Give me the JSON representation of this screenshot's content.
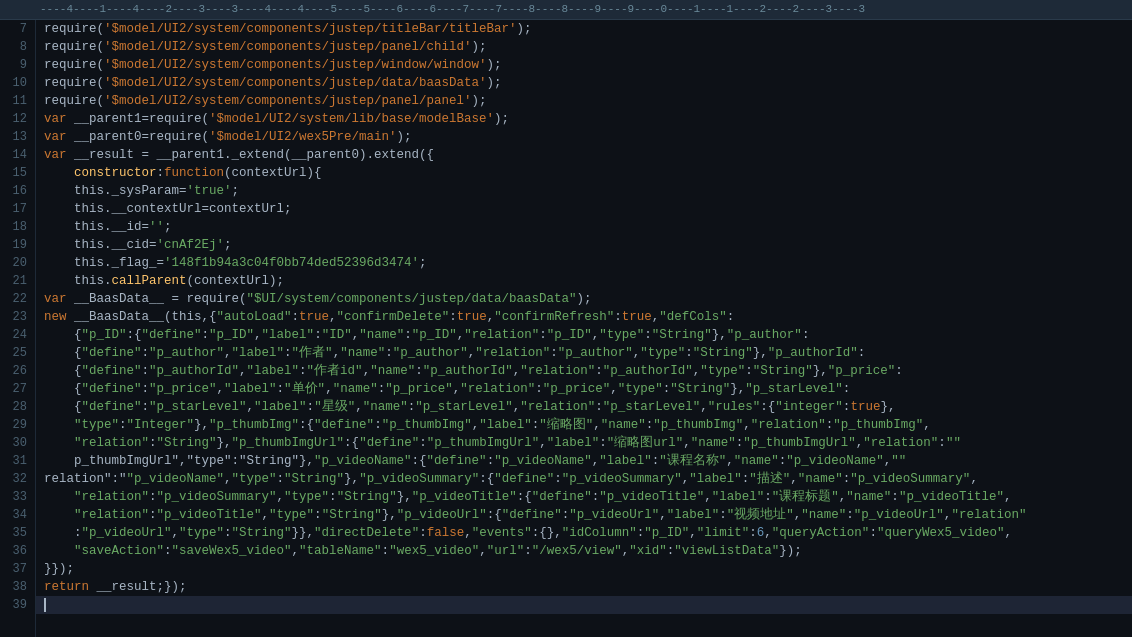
{
  "ruler": {
    "text": "----4----1----4----2----3----3----4----4----5----5----6----6----7----7----8----8----9----9----0----1----1----2----2----3----3"
  },
  "lines": [
    {
      "num": 7,
      "content": "require('<span class='str-dollar'>$model/UI2/system/components/justep/titleBar/titleBar</span><span class='white'>');</span>"
    },
    {
      "num": 8,
      "content": "require('<span class='str-dollar'>$model/UI2/system/components/justep/panel/child</span><span class='white'>');</span>"
    },
    {
      "num": 9,
      "content": "require('<span class='str-dollar'>$model/UI2/system/components/justep/window/window</span><span class='white'>');</span>"
    },
    {
      "num": 10,
      "content": "require('<span class='str-dollar'>$model/UI2/system/components/justep/data/baasData</span><span class='white'>');</span>"
    },
    {
      "num": 11,
      "content": "require('<span class='str-dollar'>$model/UI2/system/components/justep/panel/panel</span><span class='white'>');</span>"
    },
    {
      "num": 12,
      "content": "<span class='kw'>var</span> __parent1=require('<span class='str-dollar'>$model/UI2/system/lib/base/modelBase</span>');"
    },
    {
      "num": 13,
      "content": "<span class='kw'>var</span> __parent0=require('<span class='str-dollar'>$model/UI2/wex5Pre/main</span>');"
    },
    {
      "num": 14,
      "content": "<span class='kw'>var</span> __result = __parent1._extend(__parent0).extend({"
    },
    {
      "num": 15,
      "content": "    <span class='fn'>constructor</span>:<span class='kw'>function</span>(contextUrl){"
    },
    {
      "num": 16,
      "content": "    <span class='white'>this</span>.<span class='plain'>_sysParam</span>=<span class='green-str'>'true'</span>;"
    },
    {
      "num": 17,
      "content": "    <span class='white'>this</span>.<span class='plain'>__contextUrl</span>=contextUrl;"
    },
    {
      "num": 18,
      "content": "    <span class='white'>this</span>.<span class='plain'>__id</span>=<span class='green-str'>''</span>;"
    },
    {
      "num": 19,
      "content": "    <span class='white'>this</span>.<span class='plain'>__cid</span>=<span class='green-str'>'cnAf2Ej'</span>;"
    },
    {
      "num": 20,
      "content": "    <span class='white'>this</span>.<span class='plain'>_flag_</span>=<span class='green-str'>'148f1b94a3c04f0bb74ded52396d3474'</span>;"
    },
    {
      "num": 21,
      "content": "    <span class='white'>this</span>.<span class='fn'>callParent</span>(contextUrl);"
    },
    {
      "num": 22,
      "content": "<span class='kw'>var</span> __BaasData__ = require(<span class='green-str'>\"$UI/system/components/justep/data/baasData\"</span>);"
    },
    {
      "num": 23,
      "content": "<span class='kw'>new</span> __BaasData__(this,{<span class='green-str'>\"autoLoad\"</span>:<span class='kw'>true</span>,<span class='green-str'>\"confirmDelete\"</span>:<span class='kw'>true</span>,<span class='green-str'>\"confirmRefresh\"</span>:<span class='kw'>true</span>,<span class='green-str'>\"defCols\"</span>:"
    },
    {
      "num": 24,
      "content": "    {<span class='green-str'>\"p_ID\"</span>:{<span class='green-str'>\"define\"</span>:<span class='green-str'>\"p_ID\"</span>,<span class='green-str'>\"label\"</span>:<span class='green-str'>\"ID\"</span>,<span class='green-str'>\"name\"</span>:<span class='green-str'>\"p_ID\"</span>,<span class='green-str'>\"relation\"</span>:<span class='green-str'>\"p_ID\"</span>,<span class='green-str'>\"type\"</span>:<span class='green-str'>\"String\"</span>},<span class='green-str'>\"p_author\"</span>:"
    },
    {
      "num": 25,
      "content": "    {<span class='green-str'>\"define\"</span>:<span class='green-str'>\"p_author\"</span>,<span class='green-str'>\"label\"</span>:<span class='green-str'>\"作者\"</span>,<span class='green-str'>\"name\"</span>:<span class='green-str'>\"p_author\"</span>,<span class='green-str'>\"relation\"</span>:<span class='green-str'>\"p_author\"</span>,<span class='green-str'>\"type\"</span>:<span class='green-str'>\"String\"</span>},<span class='green-str'>\"p_authorId\"</span>:"
    },
    {
      "num": 26,
      "content": "    {<span class='green-str'>\"define\"</span>:<span class='green-str'>\"p_authorId\"</span>,<span class='green-str'>\"label\"</span>:<span class='green-str'>\"作者id\"</span>,<span class='green-str'>\"name\"</span>:<span class='green-str'>\"p_authorId\"</span>,<span class='green-str'>\"relation\"</span>:<span class='green-str'>\"p_authorId\"</span>,<span class='green-str'>\"type\"</span>:<span class='green-str'>\"String\"</span>},<span class='green-str'>\"p_price\"</span>:"
    },
    {
      "num": 27,
      "content": "    {<span class='green-str'>\"define\"</span>:<span class='green-str'>\"p_price\"</span>,<span class='green-str'>\"label\"</span>:<span class='green-str'>\"单价\"</span>,<span class='green-str'>\"name\"</span>:<span class='green-str'>\"p_price\"</span>,<span class='green-str'>\"relation\"</span>:<span class='green-str'>\"p_price\"</span>,<span class='green-str'>\"type\"</span>:<span class='green-str'>\"String\"</span>},<span class='green-str'>\"p_starLevel\"</span>:"
    },
    {
      "num": 28,
      "content": "    {<span class='green-str'>\"define\"</span>:<span class='green-str'>\"p_starLevel\"</span>,<span class='green-str'>\"label\"</span>:<span class='green-str'>\"星级\"</span>,<span class='green-str'>\"name\"</span>:<span class='green-str'>\"p_starLevel\"</span>,<span class='green-str'>\"relation\"</span>:<span class='green-str'>\"p_starLevel\"</span>,<span class='green-str'>\"rules\"</span>:{<span class='green-str'>\"integer\"</span>:<span class='kw'>true</span>},"
    },
    {
      "num": 29,
      "content": "    <span class='green-str'>\"type\"</span>:<span class='green-str'>\"Integer\"</span>},<span class='green-str'>\"p_thumbImg\"</span>:{<span class='green-str'>\"define\"</span>:<span class='green-str'>\"p_thumbImg\"</span>,<span class='green-str'>\"label\"</span>:<span class='green-str'>\"缩略图\"</span>,<span class='green-str'>\"name\"</span>:<span class='green-str'>\"p_thumbImg\"</span>,<span class='green-str'>\"relation\"</span>:<span class='green-str'>\"p_thumbImg\"</span>,"
    },
    {
      "num": 30,
      "content": "    <span class='green-str'>\"relation\"</span>:<span class='green-str'>\"String\"</span>},<span class='green-str'>\"p_thumbImgUrl\"</span>:{<span class='green-str'>\"define\"</span>:<span class='green-str'>\"p_thumbImgUrl\"</span>,<span class='green-str'>\"label\"</span>:<span class='green-str'>\"缩略图url\"</span>,<span class='green-str'>\"name\"</span>:<span class='green-str'>\"p_thumbImgUrl\"</span>,<span class='green-str'>\"relation\"</span>:<span class='green-str'>\"\"</span>"
    },
    {
      "num": 31,
      "content": "    p_thumbImgUrl\",<span class='green-str'>\"type\"</span>:<span class='green-str'>\"String\"</span>},<span class='green-str'>\"p_videoName\"</span>:{<span class='green-str'>\"define\"</span>:<span class='green-str'>\"p_videoName\"</span>,<span class='green-str'>\"label\"</span>:<span class='green-str'>\"课程名称\"</span>,<span class='green-str'>\"name\"</span>:<span class='green-str'>\"p_videoName\"</span>,<span class='green-str'>\"\"</span>"
    },
    {
      "num": 32,
      "content": "relation\":<span class='green-str'>\"p_videoName\"</span>,<span class='green-str'>\"type\"</span>:<span class='green-str'>\"String\"</span>},<span class='green-str'>\"p_videoSummary\"</span>:{<span class='green-str'>\"define\"</span>:<span class='green-str'>\"p_videoSummary\"</span>,<span class='green-str'>\"label\"</span>:<span class='green-str'>\"描述\"</span>,<span class='green-str'>\"name\"</span>:<span class='green-str'>\"p_videoSummary\"</span>,"
    },
    {
      "num": 33,
      "content": "    <span class='green-str'>\"relation\"</span>:<span class='green-str'>\"p_videoSummary\"</span>,<span class='green-str'>\"type\"</span>:<span class='green-str'>\"String\"</span>},<span class='green-str'>\"p_videoTitle\"</span>:{<span class='green-str'>\"define\"</span>:<span class='green-str'>\"p_videoTitle\"</span>,<span class='green-str'>\"label\"</span>:<span class='green-str'>\"课程标题\"</span>,<span class='green-str'>\"name\"</span>:<span class='green-str'>\"p_videoTitle\"</span>,"
    },
    {
      "num": 34,
      "content": "    <span class='green-str'>\"relation\"</span>:<span class='green-str'>\"p_videoTitle\"</span>,<span class='green-str'>\"type\"</span>:<span class='green-str'>\"String\"</span>},<span class='green-str'>\"p_videoUrl\"</span>:{<span class='green-str'>\"define\"</span>:<span class='green-str'>\"p_videoUrl\"</span>,<span class='green-str'>\"label\"</span>:<span class='green-str'>\"视频地址\"</span>,<span class='green-str'>\"name\"</span>:<span class='green-str'>\"p_videoUrl\"</span>,<span class='green-str'>\"relation\"</span>"
    },
    {
      "num": 35,
      "content": "    :<span class='green-str'>\"p_videoUrl\"</span>,<span class='green-str'>\"type\"</span>:<span class='green-str'>\"String\"</span>}},<span class='green-str'>\"directDelete\"</span>:<span class='kw'>false</span>,<span class='green-str'>\"events\"</span>:{},<span class='green-str'>\"idColumn\"</span>:<span class='green-str'>\"p_ID\"</span>,<span class='green-str'>\"limit\"</span>:<span class='num'>6</span>,<span class='green-str'>\"queryAction\"</span>:<span class='green-str'>\"queryWex5_video\"</span>,"
    },
    {
      "num": 36,
      "content": "    <span class='green-str'>\"saveAction\"</span>:<span class='green-str'>\"saveWex5_video\"</span>,<span class='green-str'>\"tableName\"</span>:<span class='green-str'>\"wex5_video\"</span>,<span class='green-str'>\"url\"</span>:<span class='green-str'>\"/wex5/view\"</span>,<span class='green-str'>\"xid\"</span>:<span class='green-str'>\"viewListData\"</span>});"
    },
    {
      "num": 37,
      "content": "}});"
    },
    {
      "num": 38,
      "content": "<span class='kw'>return</span> __result;});"
    },
    {
      "num": 39,
      "content": "<span class='cursor'>|</span>"
    }
  ]
}
